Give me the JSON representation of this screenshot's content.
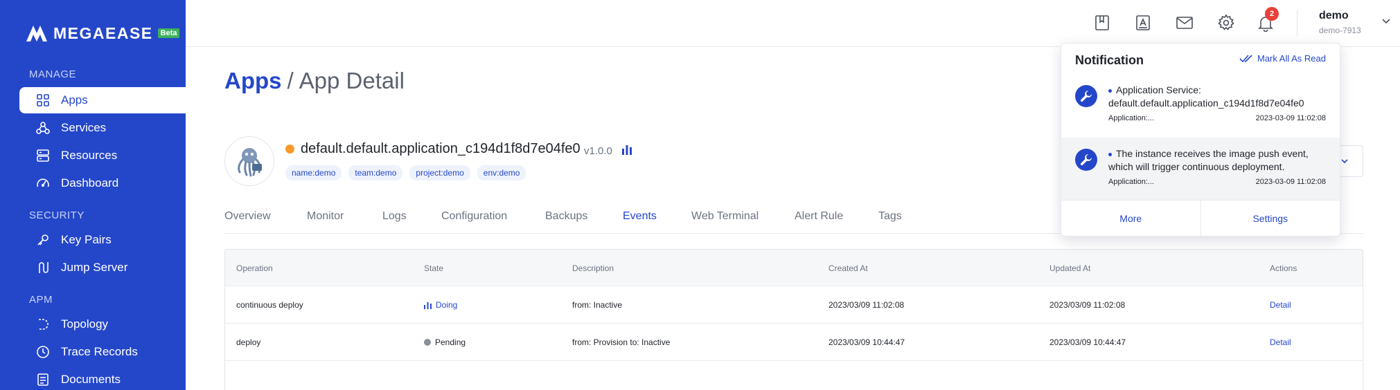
{
  "brand": {
    "name": "MEGAEASE",
    "badge": "Beta",
    "brand_color": "#2447c9"
  },
  "sidebar": {
    "sections": [
      {
        "title": "MANAGE"
      },
      {
        "title": "SECURITY"
      },
      {
        "title": "APM"
      }
    ],
    "items": [
      {
        "label": "Apps",
        "icon": "apps-grid-icon",
        "active": true
      },
      {
        "label": "Services",
        "icon": "services-icon"
      },
      {
        "label": "Resources",
        "icon": "resources-icon"
      },
      {
        "label": "Dashboard",
        "icon": "dashboard-icon"
      },
      {
        "label": "Key Pairs",
        "icon": "key-icon"
      },
      {
        "label": "Jump Server",
        "icon": "jump-server-icon"
      },
      {
        "label": "Topology",
        "icon": "topology-icon"
      },
      {
        "label": "Trace Records",
        "icon": "clock-icon"
      },
      {
        "label": "Documents",
        "icon": "document-icon"
      }
    ]
  },
  "topbar": {
    "icons": [
      "bookmark-icon",
      "app-store-icon",
      "mail-icon",
      "gear-icon",
      "bell-icon"
    ],
    "notification_count": "2",
    "user": {
      "name": "demo",
      "sub": "demo-7913"
    }
  },
  "breadcrumb": {
    "root": "Apps",
    "separator": "/",
    "current": "App Detail"
  },
  "app": {
    "name": "default.default.application_c194d1f8d7e04fe0",
    "version": "v1.0.0",
    "status_color": "#f79a2b",
    "tags": [
      "name:demo",
      "team:demo",
      "project:demo",
      "env:demo"
    ]
  },
  "tabs": [
    "Overview",
    "Monitor",
    "Logs",
    "Configuration",
    "Backups",
    "Events",
    "Web Terminal",
    "Alert Rule",
    "Tags"
  ],
  "active_tab": "Events",
  "table": {
    "columns": [
      "Operation",
      "State",
      "Description",
      "Created At",
      "Updated At",
      "Actions"
    ],
    "rows": [
      {
        "operation": "continuous deploy",
        "state": "Doing",
        "description": "from: Inactive",
        "created": "2023/03/09 11:02:08",
        "updated": "2023/03/09 11:02:08",
        "action": "Detail"
      },
      {
        "operation": "deploy",
        "state": "Pending",
        "description": "from: Provision to: Inactive",
        "created": "2023/03/09 10:44:47",
        "updated": "2023/03/09 10:44:47",
        "action": "Detail"
      }
    ]
  },
  "notifications": {
    "title": "Notification",
    "mark_all": "Mark All As Read",
    "items": [
      {
        "line1": "Application Service:",
        "line2": "default.default.application_c194d1f8d7e04fe0",
        "meta": "Application:...",
        "time": "2023-03-09 11:02:08"
      },
      {
        "line1": "The instance receives the image push event,",
        "line2": "which will trigger continuous deployment.",
        "meta": "Application:...",
        "time": "2023-03-09 11:02:08"
      }
    ],
    "more_label": "More",
    "settings_label": "Settings"
  }
}
